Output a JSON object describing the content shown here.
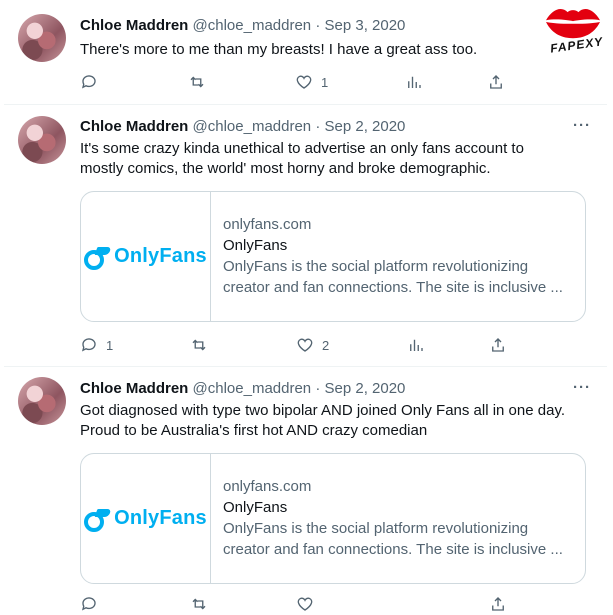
{
  "watermark": {
    "text": "FAPEXY",
    "lips_color": "#e3000f"
  },
  "brand": {
    "onlyfans_color": "#00aff0",
    "logo_text": "OnlyFans"
  },
  "tweets": [
    {
      "name": "Chloe Maddren",
      "handle": "@chloe_maddren",
      "date": "· Sep 3, 2020",
      "text": "There's more to me than my breasts! I have a great ass too.",
      "replies": "",
      "retweets": "",
      "likes": "1"
    },
    {
      "name": "Chloe Maddren",
      "handle": "@chloe_maddren",
      "date": "· Sep 2, 2020",
      "text": "It's some crazy kinda unethical to advertise an only fans account to mostly comics, the world' most horny and broke demographic.",
      "card": {
        "domain": "onlyfans.com",
        "title": "OnlyFans",
        "description": "OnlyFans is the social platform revolutionizing creator and fan connections. The site is inclusive ..."
      },
      "replies": "1",
      "retweets": "",
      "likes": "2"
    },
    {
      "name": "Chloe Maddren",
      "handle": "@chloe_maddren",
      "date": "· Sep 2, 2020",
      "text": "Got diagnosed with type two bipolar AND joined Only Fans all in one day. Proud to be Australia's first hot AND crazy comedian",
      "card": {
        "domain": "onlyfans.com",
        "title": "OnlyFans",
        "description": "OnlyFans is the social platform revolutionizing creator and fan connections. The site is inclusive ..."
      }
    }
  ],
  "more_label": "···"
}
